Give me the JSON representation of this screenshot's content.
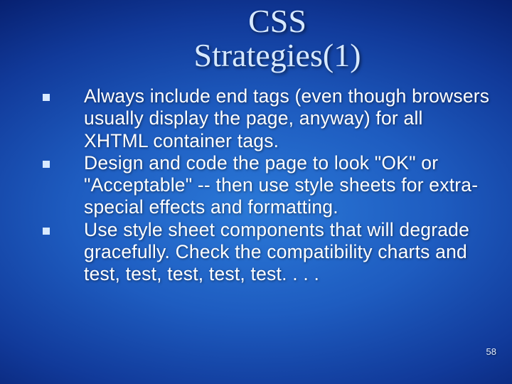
{
  "slide": {
    "title_line1": "CSS",
    "title_line2": "Strategies(1)",
    "bullets": [
      "Always include end tags (even though browsers usually display the page, anyway) for all XHTML container tags.",
      "Design and code the page to look \"OK\" or \"Acceptable\" -- then use style sheets for extra-special effects and formatting.",
      "Use style sheet components that will degrade gracefully. Check the compatibility charts and test, test, test, test, test. . . ."
    ],
    "page_number": "58"
  }
}
